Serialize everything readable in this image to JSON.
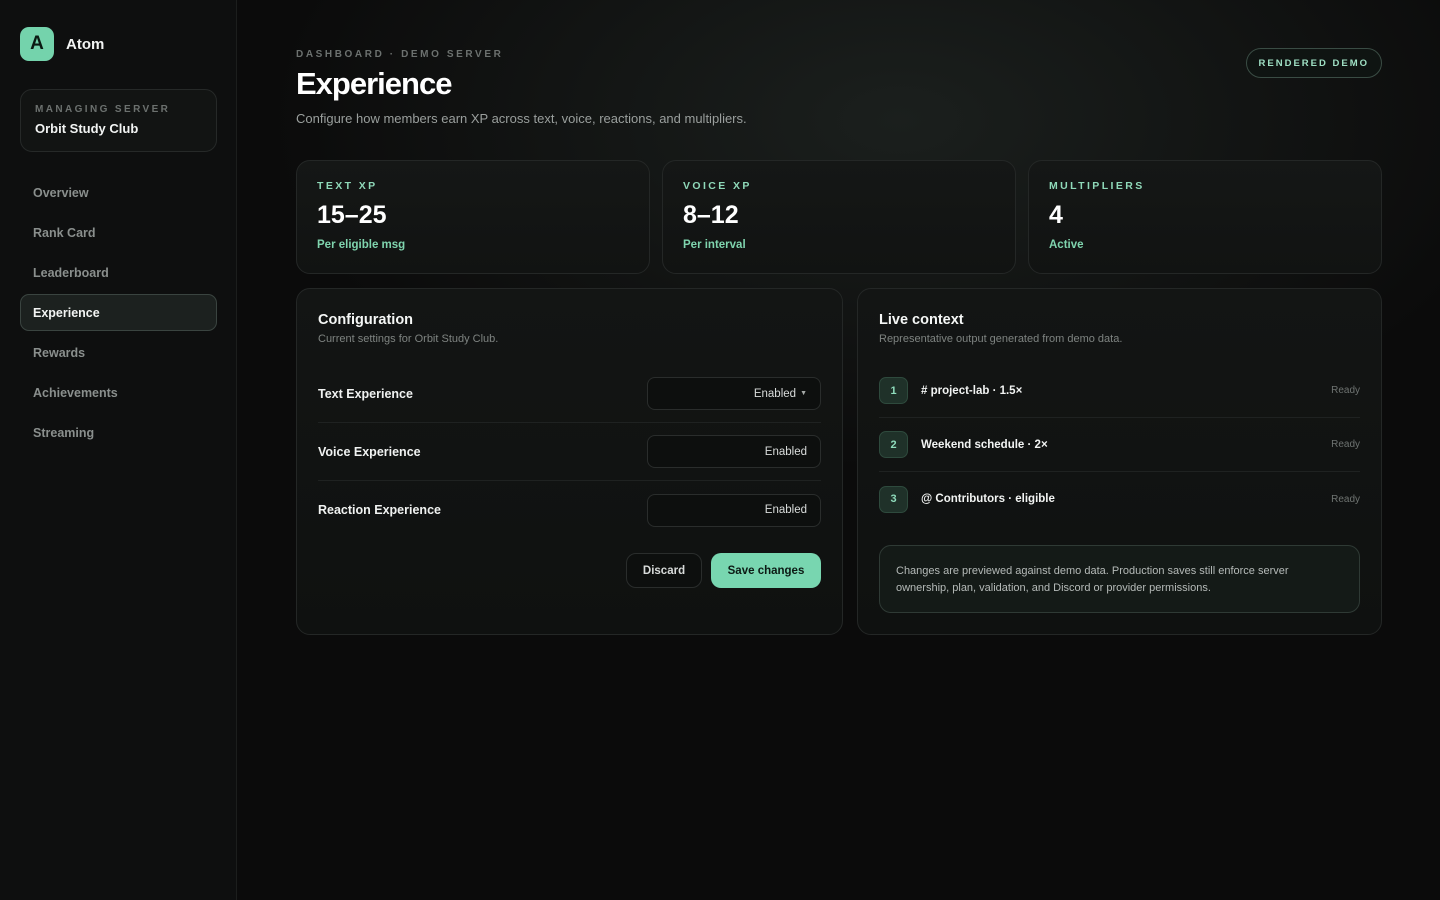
{
  "brand": {
    "initial": "A",
    "name": "Atom"
  },
  "server": {
    "label": "MANAGING SERVER",
    "name": "Orbit Study Club"
  },
  "nav": [
    {
      "label": "Overview",
      "active": false
    },
    {
      "label": "Rank Card",
      "active": false
    },
    {
      "label": "Leaderboard",
      "active": false
    },
    {
      "label": "Experience",
      "active": true
    },
    {
      "label": "Rewards",
      "active": false
    },
    {
      "label": "Achievements",
      "active": false
    },
    {
      "label": "Streaming",
      "active": false
    }
  ],
  "header": {
    "breadcrumb": "DASHBOARD · DEMO SERVER",
    "title": "Experience",
    "subtitle": "Configure how members earn XP across text, voice, reactions, and multipliers.",
    "badge": "RENDERED DEMO"
  },
  "stats": [
    {
      "label": "TEXT XP",
      "value": "15–25",
      "sub": "Per eligible msg"
    },
    {
      "label": "VOICE XP",
      "value": "8–12",
      "sub": "Per interval"
    },
    {
      "label": "MULTIPLIERS",
      "value": "4",
      "sub": "Active"
    }
  ],
  "configuration": {
    "title": "Configuration",
    "description": "Current settings for Orbit Study Club.",
    "rows": [
      {
        "label": "Text Experience",
        "value": "Enabled"
      },
      {
        "label": "Voice Experience",
        "value": "Enabled"
      },
      {
        "label": "Reaction Experience",
        "value": "Enabled"
      }
    ],
    "discard_label": "Discard",
    "save_label": "Save changes"
  },
  "live_context": {
    "title": "Live context",
    "description": "Representative output generated from demo data.",
    "items": [
      {
        "num": "1",
        "text": "# project-lab · 1.5×",
        "status": "Ready"
      },
      {
        "num": "2",
        "text": "Weekend schedule · 2×",
        "status": "Ready"
      },
      {
        "num": "3",
        "text": "@ Contributors · eligible",
        "status": "Ready"
      }
    ],
    "note": "Changes are previewed against demo data. Production saves still enforce server ownership, plan, validation, and Discord or provider permissions."
  },
  "colors": {
    "accent": "#78d6b0",
    "background": "#0b0b0b"
  },
  "icons": {
    "caret": "caret-down-icon"
  }
}
